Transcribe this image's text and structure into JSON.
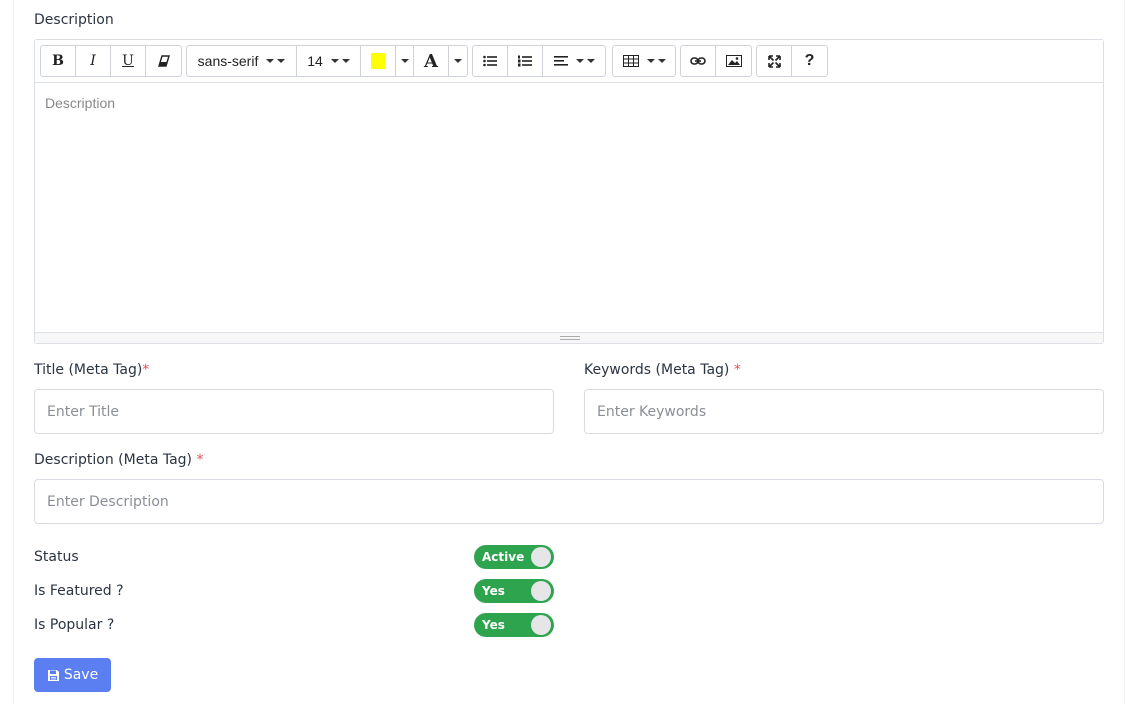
{
  "editor": {
    "section_label": "Description",
    "placeholder": "Description",
    "toolbar": {
      "bold": "B",
      "italic": "I",
      "underline": "U",
      "font_family": "sans-serif",
      "font_size": "14",
      "highlight_color": "#ffff00",
      "font_color_letter": "A",
      "help": "?"
    }
  },
  "fields": {
    "title_label": "Title (Meta Tag)",
    "title_placeholder": "Enter Title",
    "keywords_label": "Keywords (Meta Tag)",
    "keywords_placeholder": "Enter Keywords",
    "meta_desc_label": "Description (Meta Tag)",
    "meta_desc_placeholder": "Enter Description",
    "required_mark": "*"
  },
  "toggles": [
    {
      "label": "Status",
      "value": "Active"
    },
    {
      "label": "Is Featured ?",
      "value": "Yes"
    },
    {
      "label": "Is Popular ?",
      "value": "Yes"
    }
  ],
  "actions": {
    "save_label": "Save"
  },
  "colors": {
    "toggle_on": "#2fa44f",
    "save_button": "#5b7ef0",
    "required": "#e05555"
  }
}
